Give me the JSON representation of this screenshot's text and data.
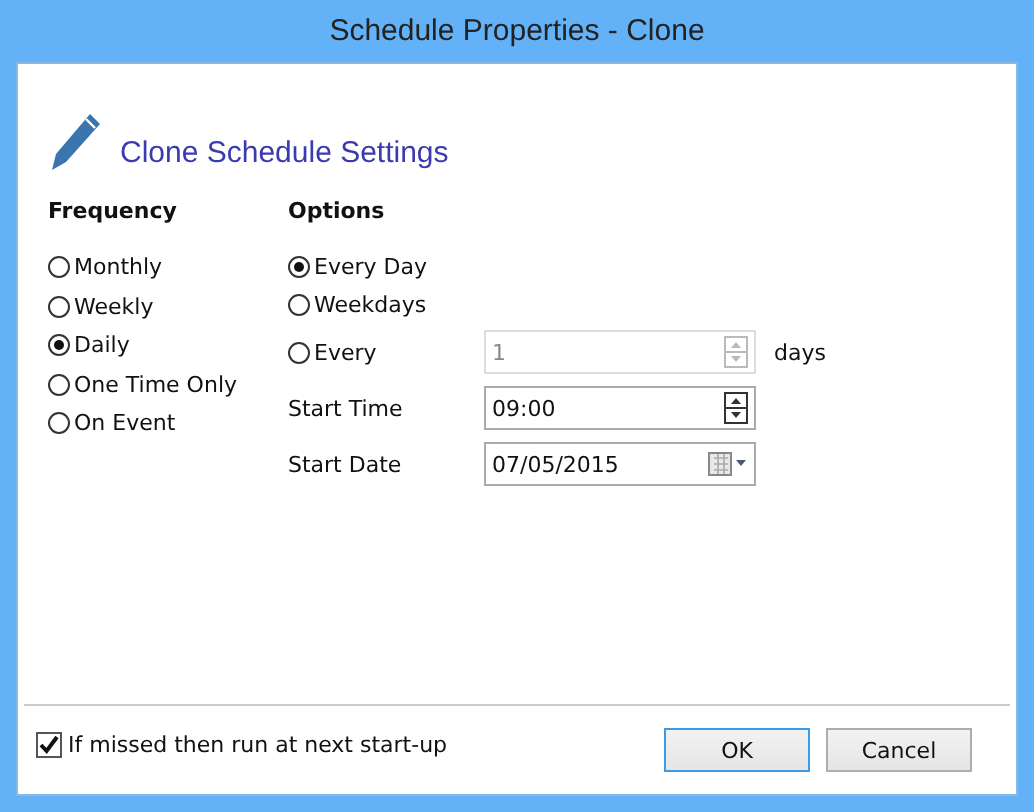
{
  "window": {
    "title": "Schedule Properties - Clone"
  },
  "header": "Clone Schedule Settings",
  "frequency": {
    "label": "Frequency",
    "options": [
      {
        "label": "Monthly",
        "selected": false
      },
      {
        "label": "Weekly",
        "selected": false
      },
      {
        "label": "Daily",
        "selected": true
      },
      {
        "label": "One Time Only",
        "selected": false
      },
      {
        "label": "On Event",
        "selected": false
      }
    ]
  },
  "options": {
    "label": "Options",
    "choices": [
      {
        "label": "Every Day",
        "selected": true
      },
      {
        "label": "Weekdays",
        "selected": false
      },
      {
        "label": "Every",
        "selected": false
      }
    ],
    "every_field": {
      "value": "1",
      "disabled": true,
      "unit": "days"
    },
    "start_time": {
      "label": "Start Time",
      "value": "09:00"
    },
    "start_date": {
      "label": "Start Date",
      "value": "07/05/2015"
    }
  },
  "missed_checkbox": {
    "label": "If missed then run at next start-up",
    "checked": true
  },
  "buttons": [
    "OK",
    "Cancel"
  ]
}
